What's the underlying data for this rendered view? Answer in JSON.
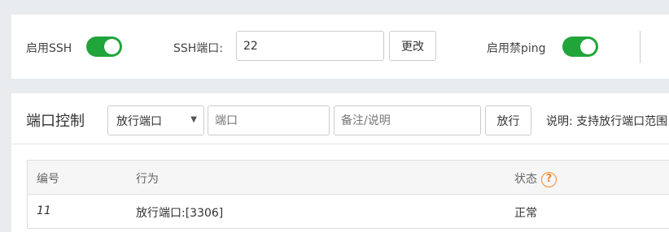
{
  "settings": {
    "ssh_enable_label": "启用SSH",
    "ssh_enabled": true,
    "ssh_port_label": "SSH端口:",
    "ssh_port_value": "22",
    "change_button": "更改",
    "ping_enable_label": "启用禁ping",
    "ping_disabled": true
  },
  "port_control": {
    "title": "端口控制",
    "mode_select": "放行端口",
    "port_placeholder": "端口",
    "note_placeholder": "备注/说明",
    "allow_button": "放行",
    "hint": "说明: 支持放行端口范围"
  },
  "table": {
    "headers": {
      "id": "编号",
      "action": "行为",
      "status": "状态",
      "help_glyph": "?"
    },
    "rows": [
      {
        "id": "11",
        "action": "放行端口:[3306]",
        "status": "正常"
      }
    ]
  },
  "colors": {
    "toggle_on": "#20a53a",
    "help_icon": "#f0892e"
  }
}
